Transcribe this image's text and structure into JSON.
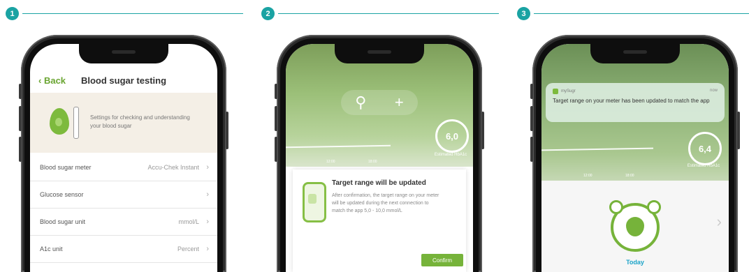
{
  "steps": [
    {
      "number": "1"
    },
    {
      "number": "2"
    },
    {
      "number": "3"
    }
  ],
  "screen1": {
    "back_label": "Back",
    "title": "Blood sugar testing",
    "banner_text": "Settings for checking and understanding your blood sugar",
    "rows": [
      {
        "label": "Blood sugar meter",
        "value": "Accu-Chek Instant"
      },
      {
        "label": "Glucose sensor",
        "value": ""
      },
      {
        "label": "Blood sugar unit",
        "value": "mmol/L"
      },
      {
        "label": "A1c unit",
        "value": "Percent"
      }
    ],
    "chevron": "›"
  },
  "screen2": {
    "search_icon": "⚲",
    "add_icon": "+",
    "gauge_value": "6,0",
    "gauge_label": "Estimated HbA1c",
    "tick_labels": [
      "12:00",
      "18:00"
    ],
    "card_title": "Target range will be updated",
    "card_text": "After confirmation, the target range on your meter will be updated during the next connection to match the app 5,0 - 10,0 mmol/L",
    "confirm_label": "Confirm"
  },
  "screen3": {
    "notif_app": "mySugr",
    "notif_time": "now",
    "notif_text": "Target range on your meter has been updated to match the app",
    "gauge_value": "6,4",
    "gauge_label": "Estimated HbA1c",
    "tick_labels": [
      "12:00",
      "18:00"
    ],
    "today_label": "Today",
    "next_arrow": "›"
  },
  "colors": {
    "accent": "#1aa3a3",
    "green": "#76b33a",
    "banner_bg": "#f4efe6"
  }
}
